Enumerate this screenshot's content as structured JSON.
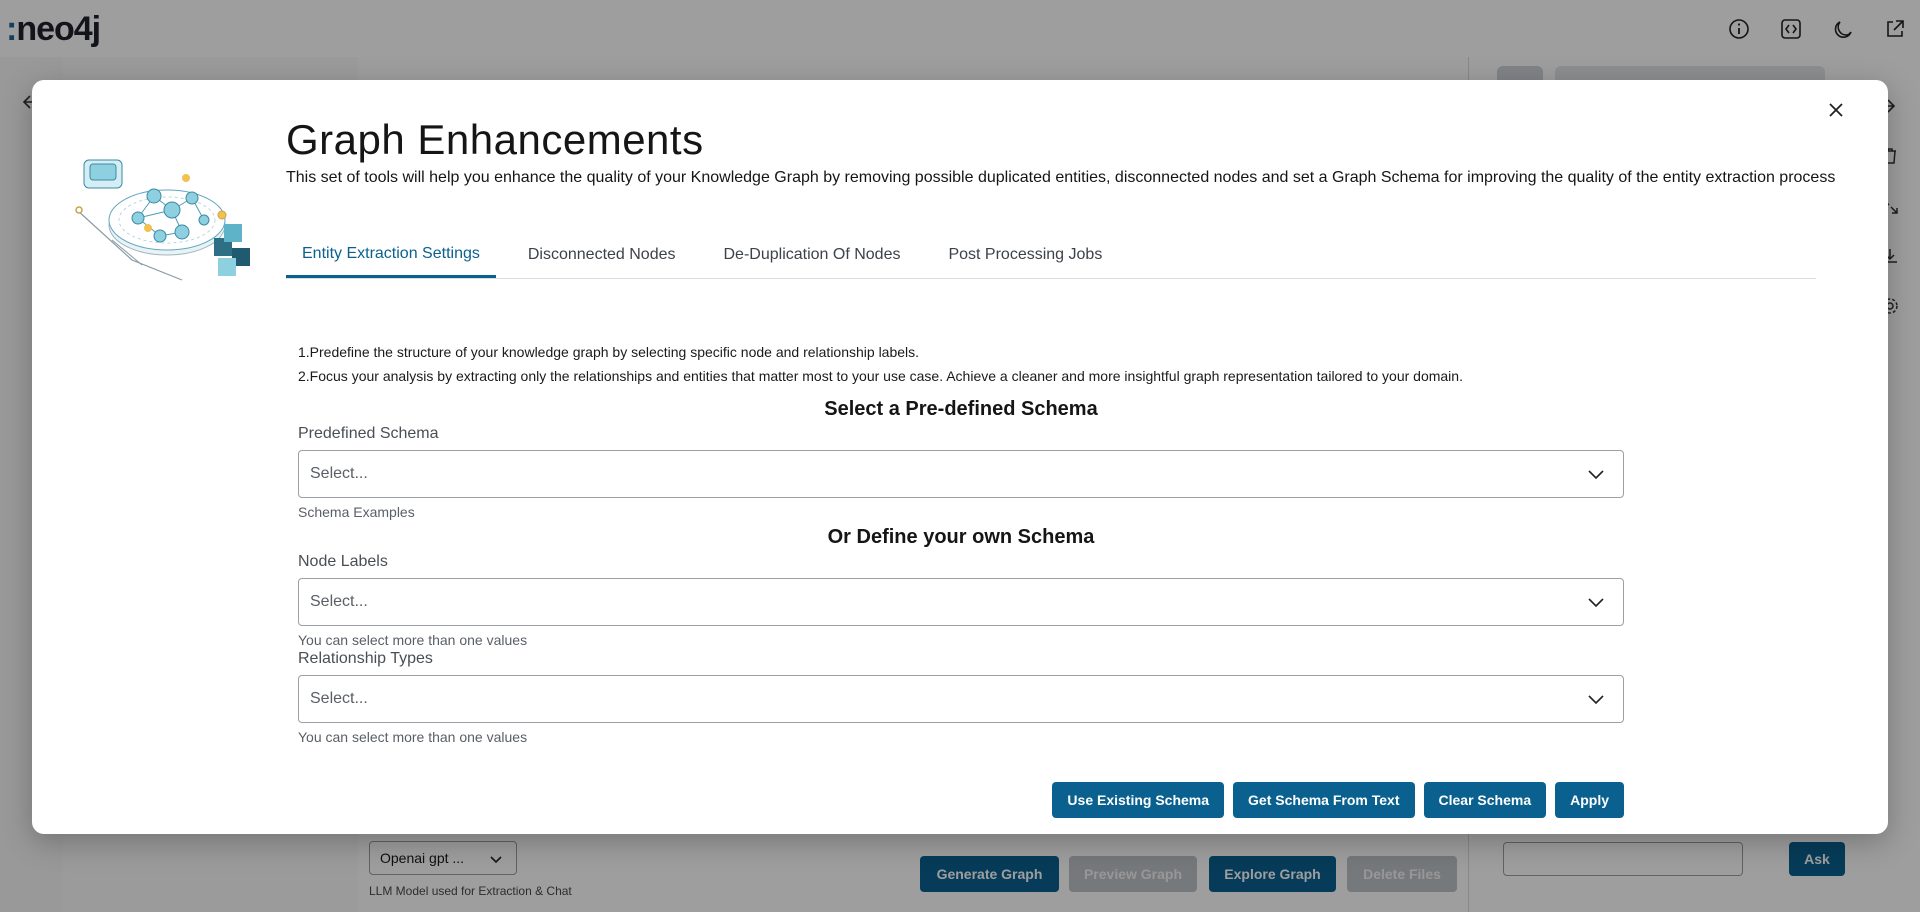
{
  "app": {
    "logo_text": "neo4j",
    "llm_model": {
      "value": "Openai gpt ...",
      "caption": "LLM Model used for Extraction & Chat"
    },
    "main_buttons": [
      "Generate Graph",
      "Preview Graph",
      "Explore Graph",
      "Delete Files"
    ],
    "chat": {
      "ask_label": "Ask"
    }
  },
  "modal": {
    "title": "Graph Enhancements",
    "description": "This set of tools will help you enhance the quality of your Knowledge Graph by removing possible duplicated entities, disconnected nodes and set a Graph Schema for improving the quality of the entity extraction process",
    "tabs": [
      {
        "label": "Entity Extraction Settings",
        "active": true
      },
      {
        "label": "Disconnected Nodes",
        "active": false
      },
      {
        "label": "De-Duplication Of Nodes",
        "active": false
      },
      {
        "label": "Post Processing Jobs",
        "active": false
      }
    ],
    "notes": [
      "1.Predefine the structure of your knowledge graph by selecting specific node and relationship labels.",
      "2.Focus your analysis by extracting only the relationships and entities that matter most to your use case. Achieve a cleaner and more insightful graph representation tailored to your domain."
    ],
    "predefined": {
      "heading": "Select a Pre-defined Schema",
      "label": "Predefined Schema",
      "placeholder": "Select...",
      "helper": "Schema Examples"
    },
    "custom": {
      "heading": "Or Define your own Schema",
      "node_labels": {
        "label": "Node Labels",
        "placeholder": "Select...",
        "helper": "You can select more than one values"
      },
      "relationship_types": {
        "label": "Relationship Types",
        "placeholder": "Select...",
        "helper": "You can select more than one values"
      }
    },
    "buttons": {
      "use_existing": "Use Existing Schema",
      "get_from_text": "Get Schema From Text",
      "clear": "Clear Schema",
      "apply": "Apply"
    }
  },
  "colors": {
    "accent": "#0a6190",
    "overlay": "rgba(0,0,0,0.38)",
    "disabled": "#bfc3c8"
  },
  "icons": {
    "top_bar": [
      "info-icon",
      "code-icon",
      "moon-icon",
      "external-link-icon"
    ],
    "right_rail": [
      "trash-icon",
      "expand-icon",
      "download-icon",
      "settings-icon"
    ],
    "dropdown": "chevron-down-icon",
    "close": "close-icon"
  }
}
